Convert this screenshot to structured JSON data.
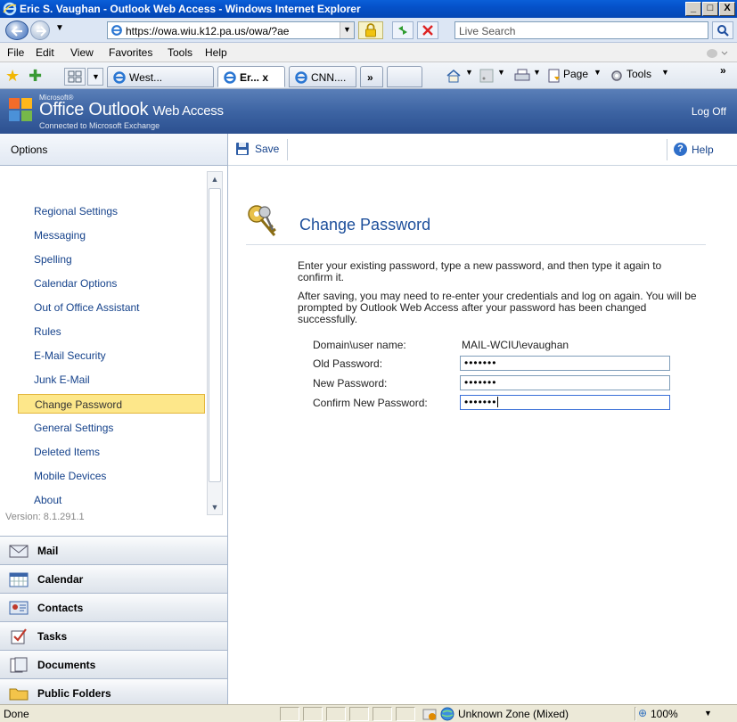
{
  "window": {
    "title": "Eric S. Vaughan - Outlook Web Access - Windows Internet Explorer",
    "minimize": "_",
    "maximize": "□",
    "close": "X"
  },
  "address": {
    "url": "https://owa.wiu.k12.pa.us/owa/?ae",
    "search_placeholder": "Live Search"
  },
  "menu": {
    "items": [
      "File",
      "Edit",
      "View",
      "Favorites",
      "Tools",
      "Help"
    ]
  },
  "tabs": {
    "items": [
      {
        "label": "West..."
      },
      {
        "label": "Er... x"
      },
      {
        "label": "CNN...."
      }
    ],
    "more": "»",
    "page_label": "Page",
    "tools_label": "Tools"
  },
  "banner": {
    "microsoft": "Microsoft®",
    "title": "Office Outlook",
    "subtitle": "Web Access",
    "connected": "Connected to Microsoft Exchange",
    "logoff": "Log Off"
  },
  "toolbar": {
    "options_header": "Options",
    "save_label": "Save",
    "help_label": "Help"
  },
  "options": {
    "items": [
      "Regional Settings",
      "Messaging",
      "Spelling",
      "Calendar Options",
      "Out of Office Assistant",
      "Rules",
      "E-Mail Security",
      "Junk E-Mail",
      "Change Password",
      "General Settings",
      "Deleted Items",
      "Mobile Devices",
      "About"
    ],
    "selected": "Change Password",
    "version": "Version: 8.1.291.1"
  },
  "nav": {
    "items": [
      "Mail",
      "Calendar",
      "Contacts",
      "Tasks",
      "Documents",
      "Public Folders"
    ]
  },
  "content": {
    "title": "Change Password",
    "intro": "Enter your existing password, type a new password, and then type it again to confirm it.",
    "note": "After saving, you may need to re-enter your credentials and log on again. You will be prompted by Outlook Web Access after your password has been changed successfully.",
    "domain_label": "Domain\\user name:",
    "domain_value": "MAIL-WCIU\\evaughan",
    "old_label": "Old Password:",
    "old_value": "•••••••",
    "new_label": "New Password:",
    "new_value": "•••••••",
    "confirm_label": "Confirm New Password:",
    "confirm_value": "•••••••"
  },
  "status": {
    "text": "Done",
    "zone": "Unknown Zone (Mixed)",
    "zoom": "100%"
  },
  "colors": {
    "link": "#15428b",
    "title": "#1d4f9b",
    "selected_bg": "#fde78a",
    "banner": "#3d64a3"
  }
}
